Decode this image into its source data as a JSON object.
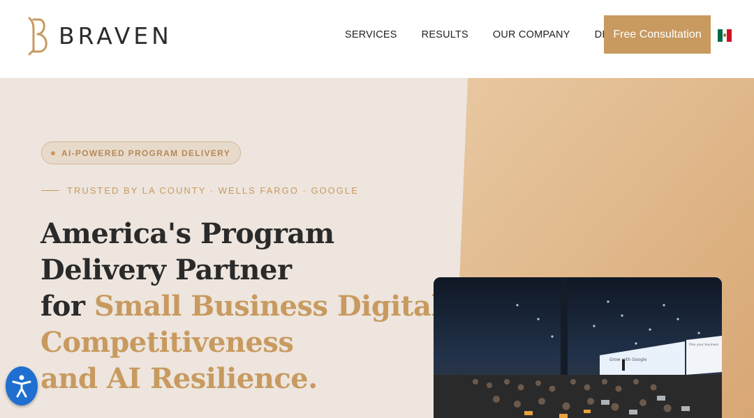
{
  "header": {
    "logo_text": "BRAVEN",
    "nav": [
      "SERVICES",
      "RESULTS",
      "OUR COMPANY",
      "DISCOVER"
    ],
    "cta_label": "Free Consultation",
    "flag_icon": "mexico-flag-icon"
  },
  "hero": {
    "badge": "AI-POWERED PROGRAM DELIVERY",
    "trusted": "TRUSTED BY LA COUNTY · WELLS FARGO · GOOGLE",
    "headline": {
      "line1": "America's Program",
      "line2": "Delivery Partner",
      "line3_prefix": "for ",
      "line3_accent": "Small Business Digital",
      "line4_accent": "Competitiveness",
      "line5_accent": "and AI Resilience."
    },
    "photo_icon": "conference-photo",
    "slide_left_text": "Grow with Google",
    "slide_right_text": "Plan your business"
  },
  "accessibility_icon": "accessibility-icon",
  "colors": {
    "accent": "#c89a5f",
    "hero_bg": "#ede5de",
    "dark_text": "#2a2a2a",
    "a11y_blue": "#1e6fd0"
  }
}
